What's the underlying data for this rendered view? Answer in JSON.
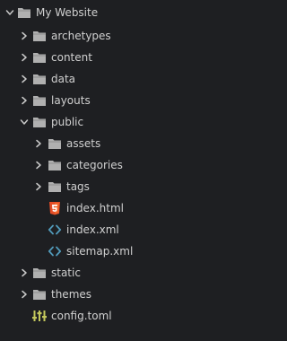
{
  "root": {
    "label": "My Website",
    "icon": "folder-icon",
    "state": "expanded"
  },
  "items": [
    {
      "label": "archetypes",
      "icon": "folder-icon",
      "state": "collapsed"
    },
    {
      "label": "content",
      "icon": "folder-icon",
      "state": "collapsed"
    },
    {
      "label": "data",
      "icon": "folder-icon",
      "state": "collapsed"
    },
    {
      "label": "layouts",
      "icon": "folder-icon",
      "state": "collapsed"
    },
    {
      "label": "public",
      "icon": "folder-icon",
      "state": "expanded",
      "children": [
        {
          "label": "assets",
          "icon": "folder-icon",
          "state": "collapsed"
        },
        {
          "label": "categories",
          "icon": "folder-icon",
          "state": "collapsed"
        },
        {
          "label": "tags",
          "icon": "folder-icon",
          "state": "collapsed"
        },
        {
          "label": "index.html",
          "icon": "html5-file-icon"
        },
        {
          "label": "index.xml",
          "icon": "xml-code-icon"
        },
        {
          "label": "sitemap.xml",
          "icon": "xml-code-icon"
        }
      ]
    },
    {
      "label": "static",
      "icon": "folder-icon",
      "state": "collapsed"
    },
    {
      "label": "themes",
      "icon": "folder-icon",
      "state": "collapsed"
    },
    {
      "label": "config.toml",
      "icon": "toml-config-icon"
    }
  ],
  "colors": {
    "background": "#1e1f22",
    "text": "#d0d0d0",
    "folder": "#b0b0b0",
    "chevron": "#c8c8c8",
    "html5": "#e44d26",
    "xml": "#519aba",
    "toml": "#c3c75c"
  }
}
